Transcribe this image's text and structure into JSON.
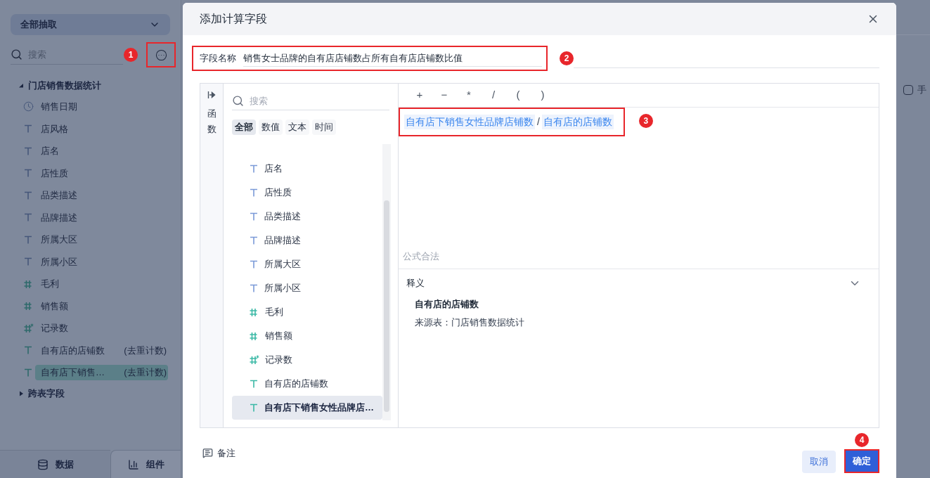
{
  "sidebar": {
    "source_dropdown": "全部抽取",
    "search": {
      "placeholder": "搜索"
    },
    "groups": [
      {
        "label": "门店销售数据统计",
        "expanded": true,
        "children": [
          {
            "label": "销售日期",
            "kind": "date",
            "selected": false
          },
          {
            "label": "店风格",
            "kind": "text",
            "selected": false
          },
          {
            "label": "店名",
            "kind": "text",
            "selected": false
          },
          {
            "label": "店性质",
            "kind": "text",
            "selected": false
          },
          {
            "label": "品类描述",
            "kind": "text",
            "selected": false
          },
          {
            "label": "品牌描述",
            "kind": "text",
            "selected": false
          },
          {
            "label": "所属大区",
            "kind": "text",
            "selected": false
          },
          {
            "label": "所属小区",
            "kind": "text",
            "selected": false
          },
          {
            "label": "毛利",
            "kind": "number",
            "selected": false
          },
          {
            "label": "销售额",
            "kind": "number",
            "selected": false
          },
          {
            "label": "记录数",
            "kind": "count",
            "selected": false
          },
          {
            "label": "自有店的店铺数",
            "suffix": "(去重计数)",
            "kind": "measure_text",
            "selected": false
          },
          {
            "label": "自有店下销售…",
            "suffix": "(去重计数)",
            "kind": "measure_text",
            "selected": true
          }
        ]
      },
      {
        "label": "跨表字段",
        "expanded": false
      }
    ],
    "bottom_tabs": [
      {
        "label": "数据",
        "kind": "data",
        "selected": true
      },
      {
        "label": "组件",
        "kind": "component",
        "selected": false
      }
    ]
  },
  "markers": [
    "1",
    "2",
    "3",
    "4"
  ],
  "background": {
    "checkbox": {
      "checked": false
    },
    "label": "手"
  },
  "dialog": {
    "title": "添加计算字段",
    "field_name": {
      "label": "字段名称",
      "value": "销售女士品牌的自有店店铺数占所有自有店店铺数比值"
    },
    "function_tab": "函数",
    "field_panel": {
      "search": {
        "placeholder": "搜索"
      },
      "filters": [
        {
          "label": "全部",
          "selected": true
        },
        {
          "label": "数值",
          "selected": false
        },
        {
          "label": "文本",
          "selected": false
        },
        {
          "label": "时间",
          "selected": false
        }
      ],
      "fields": [
        {
          "label": "店名",
          "kind": "text",
          "selected": false
        },
        {
          "label": "店性质",
          "kind": "text",
          "selected": false
        },
        {
          "label": "品类描述",
          "kind": "text",
          "selected": false
        },
        {
          "label": "品牌描述",
          "kind": "text",
          "selected": false
        },
        {
          "label": "所属大区",
          "kind": "text",
          "selected": false
        },
        {
          "label": "所属小区",
          "kind": "text",
          "selected": false
        },
        {
          "label": "毛利",
          "kind": "number",
          "selected": false
        },
        {
          "label": "销售额",
          "kind": "number",
          "selected": false
        },
        {
          "label": "记录数",
          "kind": "count",
          "selected": false
        },
        {
          "label": "自有店的店铺数",
          "kind": "measure_text",
          "selected": false
        },
        {
          "label": "自有店下销售女性品牌店…",
          "kind": "measure_text",
          "selected": true
        }
      ]
    },
    "operators": [
      "+",
      "−",
      "*",
      "/",
      "(",
      ")"
    ],
    "formula": [
      {
        "kind": "field",
        "text": "自有店下销售女性品牌店铺数"
      },
      {
        "kind": "operator",
        "text": "/"
      },
      {
        "kind": "field",
        "text": "自有店的店铺数"
      }
    ],
    "status": "公式合法",
    "explanation": {
      "title": "释义",
      "expanded": true,
      "field": "自有店的店铺数",
      "source": "来源表：门店销售数据统计"
    },
    "footer": {
      "note": "备注",
      "cancel": "取消",
      "confirm": "确定"
    }
  }
}
